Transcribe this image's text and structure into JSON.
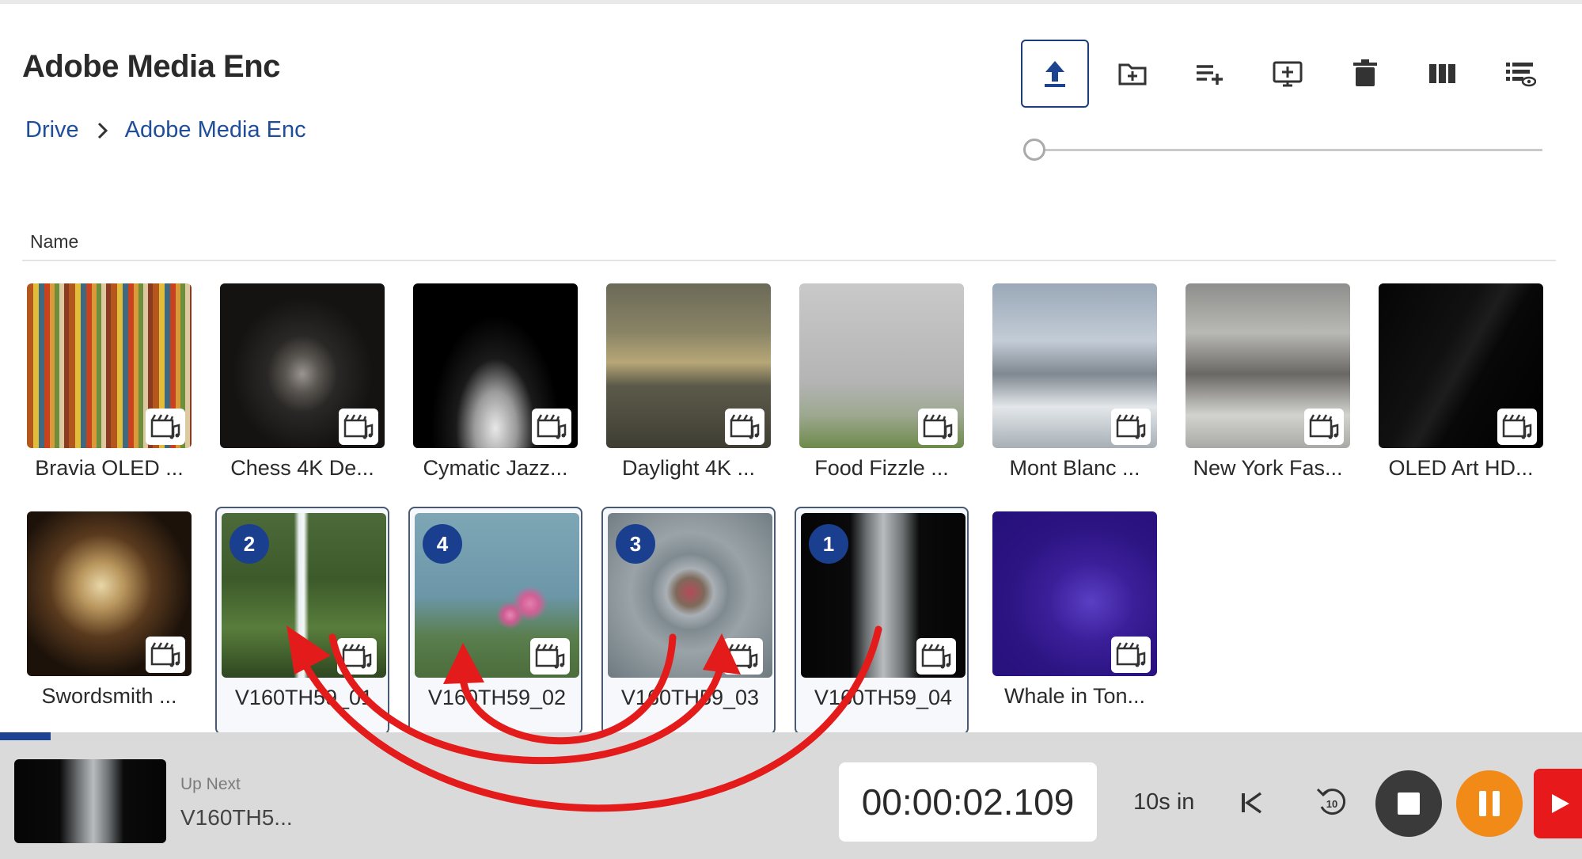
{
  "app": {
    "title": "Adobe Media Enc"
  },
  "breadcrumb": {
    "root": "Drive",
    "current": "Adobe Media Enc"
  },
  "toolbar": {
    "buttons": [
      "upload-icon",
      "new-folder-icon",
      "add-to-playlist-icon",
      "add-to-screen-icon",
      "delete-icon",
      "columns-view-icon",
      "list-view-icon"
    ],
    "active": "upload-icon"
  },
  "zoom_slider": {
    "value": 0
  },
  "list": {
    "column_header": "Name",
    "items": [
      {
        "label": "Bravia OLED ...",
        "selected": false
      },
      {
        "label": "Chess 4K De...",
        "selected": false
      },
      {
        "label": "Cymatic Jazz...",
        "selected": false
      },
      {
        "label": "Daylight 4K ...",
        "selected": false
      },
      {
        "label": "Food Fizzle ...",
        "selected": false
      },
      {
        "label": "Mont Blanc ...",
        "selected": false
      },
      {
        "label": "New York Fas...",
        "selected": false
      },
      {
        "label": "OLED Art HD...",
        "selected": false
      },
      {
        "label": "Swordsmith ...",
        "selected": false
      },
      {
        "label": "V160TH59_01",
        "selected": true,
        "order": "2"
      },
      {
        "label": "V160TH59_02",
        "selected": true,
        "order": "4"
      },
      {
        "label": "V160TH59_03",
        "selected": true,
        "order": "3"
      },
      {
        "label": "V160TH59_04",
        "selected": true,
        "order": "1"
      },
      {
        "label": "Whale in Ton...",
        "selected": false
      }
    ]
  },
  "player": {
    "progress": 0.032,
    "up_next_label": "Up Next",
    "up_next_title": "V160TH5...",
    "timecode": "00:00:02.109",
    "skip_label": "10s in",
    "controls": [
      "skip-to-start-icon",
      "replay-10-icon",
      "stop-icon",
      "pause-icon",
      "play-icon"
    ]
  },
  "colors": {
    "accent": "#1c4490",
    "badge": "#1b3f8f",
    "pause": "#f28a17",
    "live": "#e8191b",
    "annotation_arrows": "#e31b1b"
  }
}
